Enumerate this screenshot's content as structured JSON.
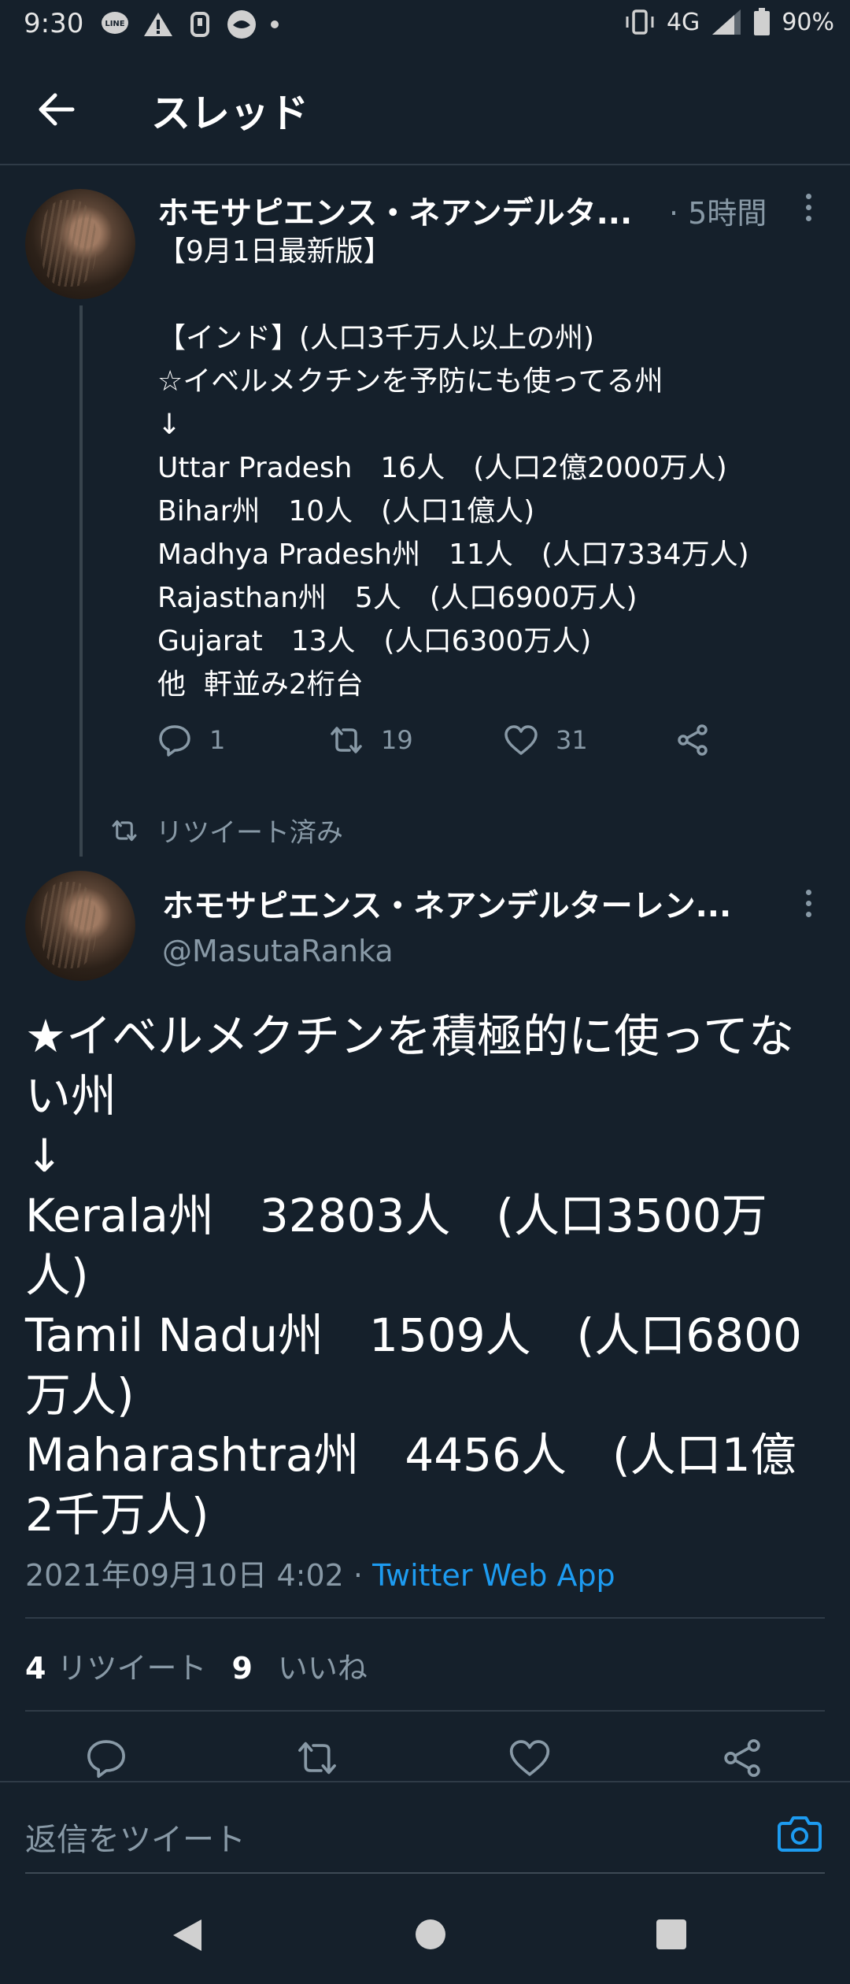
{
  "status_bar": {
    "time": "9:30",
    "network": "4G",
    "battery": "90%",
    "icons": [
      "line-icon",
      "warning-icon",
      "debug-icon",
      "app-icon",
      "dot-icon",
      "vibrate-icon",
      "signal-icon",
      "battery-icon"
    ]
  },
  "header": {
    "title": "スレッド"
  },
  "tweet1": {
    "author": "ホモサピエンス・ネアンデルタ...",
    "time": "· 5時間",
    "body": "【9月1日最新版】\n\n【インド】(人口3千万人以上の州)\n☆イベルメクチンを予防にも使ってる州\n↓\nUttar Pradesh　16人　(人口2億2000万人)\nBihar州　10人　(人口1億人)\nMadhya Pradesh州　11人　(人口7334万人)\nRajasthan州　5人　(人口6900万人)\nGujarat　13人　(人口6300万人)\n他  軒並み2桁台",
    "replies": "1",
    "retweets": "19",
    "likes": "31"
  },
  "retweet_label": "リツイート済み",
  "tweet2": {
    "author": "ホモサピエンス・ネアンデルターレン...",
    "handle": "@MasutaRanka",
    "body": "★イベルメクチンを積極的に使ってない州\n↓\nKerala州　32803人　(人口3500万人)\nTamil Nadu州　1509人　(人口6800万人)\nMaharashtra州　4456人　(人口1億2千万人)",
    "date": "2021年09月10日 4:02 · ",
    "source": "Twitter Web App",
    "retweet_count": "4",
    "retweet_label": "リツイート",
    "like_count": "9",
    "like_label": "いいね"
  },
  "reply_bar": {
    "placeholder": "返信をツイート"
  },
  "colors": {
    "background": "#15202b",
    "secondary_text": "#8899a6",
    "accent": "#1d9bf0",
    "divider": "#2f3b47"
  }
}
